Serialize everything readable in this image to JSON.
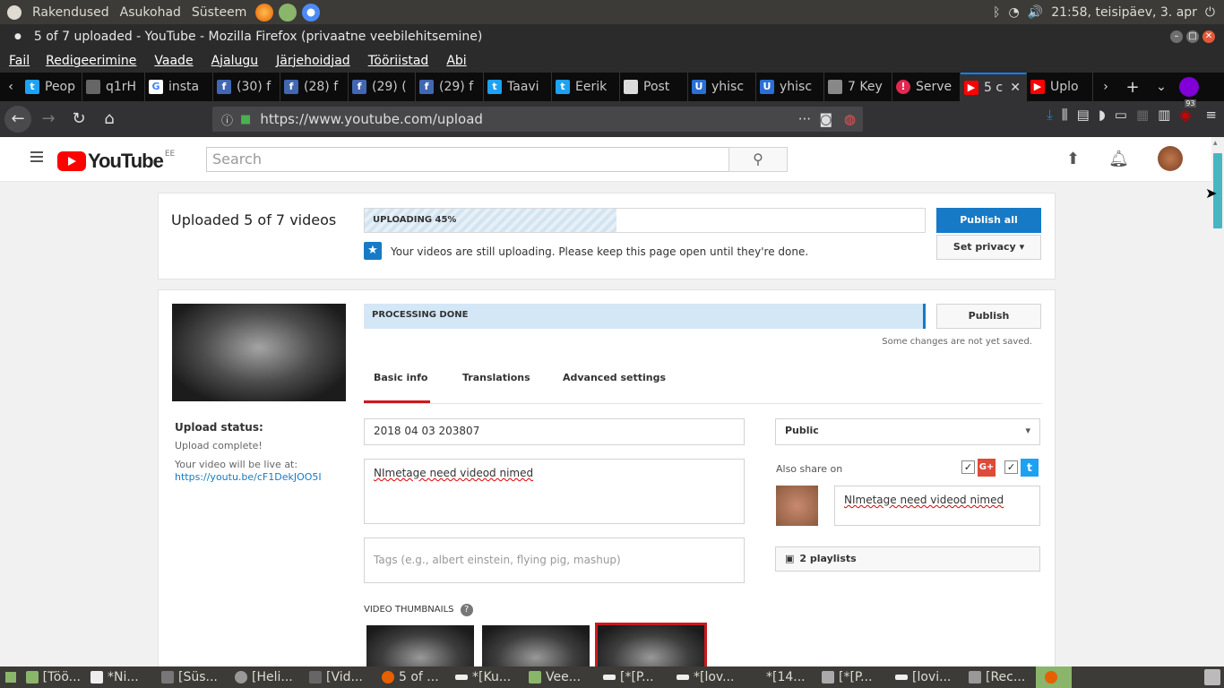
{
  "os": {
    "menus": [
      "Rakendused",
      "Asukohad",
      "Süsteem"
    ],
    "clock": "21:58, teisipäev,  3. apr"
  },
  "window": {
    "title": "5 of 7 uploaded - YouTube - Mozilla Firefox (privaatne veebilehitsemine)"
  },
  "menubar": [
    "Fail",
    "Redigeerimine",
    "Vaade",
    "Ajalugu",
    "Järjehoidjad",
    "Tööriistad",
    "Abi"
  ],
  "tabs": [
    {
      "label": "Peop",
      "icon": "twitter-icon",
      "color": "#1da1f2"
    },
    {
      "label": "q1rH",
      "icon": "image-icon",
      "color": "#666666"
    },
    {
      "label": "insta",
      "icon": "google-icon",
      "color": "#ffffff"
    },
    {
      "label": "(30) f",
      "icon": "facebook-icon",
      "color": "#4267b2"
    },
    {
      "label": "(28) f",
      "icon": "facebook-icon",
      "color": "#4267b2"
    },
    {
      "label": "(29) (",
      "icon": "facebook-icon",
      "color": "#4267b2"
    },
    {
      "label": "(29) f",
      "icon": "facebook-icon",
      "color": "#4267b2"
    },
    {
      "label": "Taavi",
      "icon": "twitter-icon",
      "color": "#1da1f2"
    },
    {
      "label": "Eerik",
      "icon": "twitter-icon",
      "color": "#1da1f2"
    },
    {
      "label": "Post",
      "icon": "document-icon",
      "color": "#dddddd"
    },
    {
      "label": "yhisc",
      "icon": "up-icon",
      "color": "#2b6fd6"
    },
    {
      "label": "yhisc",
      "icon": "up-icon",
      "color": "#2b6fd6"
    },
    {
      "label": "7 Key",
      "icon": "stack-icon",
      "color": "#888888"
    },
    {
      "label": "Serve",
      "icon": "error-icon",
      "color": "#e22850"
    },
    {
      "label": "5 c",
      "icon": "youtube-icon",
      "color": "#ff0000",
      "active": true
    },
    {
      "label": "Uplo",
      "icon": "youtube-icon",
      "color": "#ff0000"
    }
  ],
  "nav": {
    "url": "https://www.youtube.com/upload",
    "badge": "93"
  },
  "yt": {
    "search_placeholder": "Search",
    "country": "EE"
  },
  "upload": {
    "heading": "Uploaded 5 of 7 videos",
    "progress_label": "UPLOADING 45%",
    "progress": 0.45,
    "notice": "Your videos are still uploading. Please keep this page open until they're done.",
    "publish_all": "Publish all",
    "set_privacy": "Set privacy"
  },
  "video": {
    "processing_label": "PROCESSING DONE",
    "publish": "Publish",
    "unsaved": "Some changes are not yet saved.",
    "tabs": [
      "Basic info",
      "Translations",
      "Advanced settings"
    ],
    "upload_status_title": "Upload status:",
    "upload_status": "Upload complete!",
    "live_text": "Your video will be live at:",
    "live_link": "https://youtu.be/cF1DekJOO5I",
    "title_value": "2018 04 03 203807",
    "description": "NImetage need videod nimed",
    "tags_placeholder": "Tags (e.g., albert einstein, flying pig, mashup)",
    "privacy": "Public",
    "share_label": "Also share on",
    "share_message": "NImetage need videod nimed",
    "playlists": "2 playlists",
    "thumbnails_label": "VIDEO THUMBNAILS"
  },
  "taskbar": [
    {
      "label": "[Töö..."
    },
    {
      "label": "*Ni..."
    },
    {
      "label": "[Süs..."
    },
    {
      "label": "[Heli..."
    },
    {
      "label": "[Vid..."
    },
    {
      "label": "5 of ..."
    },
    {
      "label": "*[Ku..."
    },
    {
      "label": "Vee..."
    },
    {
      "label": "[*[P..."
    },
    {
      "label": "*[lov..."
    },
    {
      "label": "*[14..."
    },
    {
      "label": "[*[P..."
    },
    {
      "label": "[lovi..."
    },
    {
      "label": "[Rec..."
    }
  ]
}
